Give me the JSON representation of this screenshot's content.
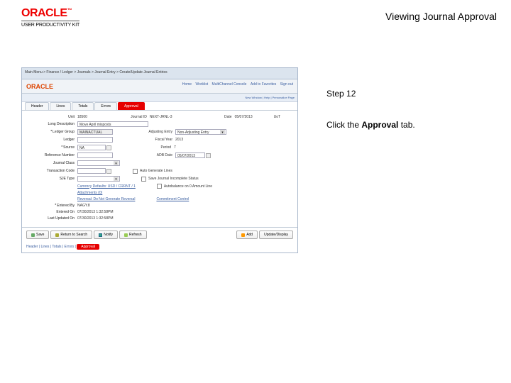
{
  "brand": {
    "logo": "ORACLE",
    "tm": "™",
    "product": "USER PRODUCTIVITY KIT"
  },
  "page": {
    "title": "Viewing Journal Approval"
  },
  "instruction": {
    "step": "Step 12",
    "prefix": "Click the ",
    "bold": "Approval",
    "suffix": " tab."
  },
  "app": {
    "breadcrumb": "Main Menu > Finance / Ledger > Journals > Journal Entry > Create/Update Journal Entries",
    "nav": [
      "Home",
      "Worklist",
      "MultiChannel Console",
      "Add to Favorites",
      "Sign out"
    ],
    "toolbar_right": "New Window | Help | Personalize Page",
    "tabs": {
      "header": "Header",
      "lines": "Lines",
      "totals": "Totals",
      "errors": "Errors",
      "approval": "Approval"
    },
    "form": {
      "unit": {
        "label": "Unit",
        "value": "18500"
      },
      "journal_id": {
        "label": "Journal ID",
        "value": "NEXT-JRNL-3"
      },
      "date": {
        "label": "Date",
        "value": "05/07/2013"
      },
      "long_desc": {
        "label": "Long Description",
        "value": "Move April misposts"
      },
      "ledger_group": {
        "label": "Ledger Group",
        "value": "MAINACTUAL"
      },
      "adjusting_entry": {
        "label": "Adjusting Entry",
        "value": "Non-Adjusting Entry"
      },
      "ledger": {
        "label": "Ledger"
      },
      "fiscal_year": {
        "label": "Fiscal Year",
        "value": "2013"
      },
      "source": {
        "label": "Source",
        "value": "NA"
      },
      "period": {
        "label": "Period",
        "value": "7"
      },
      "ref_no": {
        "label": "Reference Number"
      },
      "adb_date": {
        "label": "ADB Date",
        "value": "05/07/2013"
      },
      "journal_class": {
        "label": "Journal Class"
      },
      "trans_code": {
        "label": "Transaction Code"
      },
      "auto_gen": {
        "label": "Auto Generate Lines"
      },
      "sjetype": {
        "label": "SJE Type"
      },
      "save_incomplete": {
        "label": "Save Journal Incomplete Status"
      },
      "currency_def": {
        "link": "Currency Defaults: USD / CRRNT / 1"
      },
      "autobalance": {
        "label": "Autobalance on 0 Amount Line"
      },
      "attachments": {
        "link": "Attachments (0)"
      },
      "reversal": {
        "link": "Reversal: Do Not Generate Reversal"
      },
      "commitment": {
        "link": "Commitment Control"
      },
      "entered_by": {
        "label": "Entered By",
        "value": "NAGY.8"
      },
      "entered_on": {
        "label": "Entered On",
        "value": "07/30/2013 1:32:58PM"
      },
      "last_updated": {
        "label": "Last Updated On",
        "value": "07/30/2013 1:32:58PM"
      },
      "uot": "UoT"
    },
    "buttons": {
      "save": "Save",
      "return": "Return to Search",
      "notify": "Notify",
      "refresh": "Refresh",
      "add": "Add",
      "update": "Update/Display"
    },
    "lower_tabs": "Header | Lines | Totals | Errors |",
    "lower_active": "Approval"
  }
}
